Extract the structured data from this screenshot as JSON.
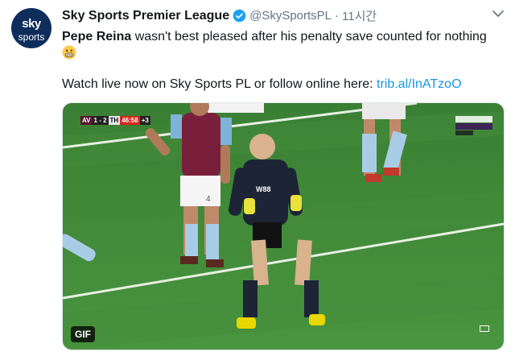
{
  "account": {
    "avatar_line1": "sky",
    "avatar_line2": "sports",
    "name": "Sky Sports Premier League",
    "handle": "@SkySportsPL",
    "separator": "·",
    "time": "11시간"
  },
  "tweet": {
    "subject": "Pepe Reina",
    "body": " wasn't best pleased after his penalty save counted for nothing ",
    "emoji": "grimacing-face-icon",
    "cta": "Watch live now on Sky Sports PL or follow online here: ",
    "link": "trib.al/InATzoO"
  },
  "media": {
    "scorebug": {
      "team1": "AV",
      "score": "1 - 2",
      "team2": "TH",
      "clock": "46:58",
      "extra": "+3"
    },
    "badge": "GIF",
    "player_sponsor": "W88",
    "player_number": "4"
  },
  "colors": {
    "link": "#1b95e0",
    "verified": "#1da1f2",
    "pitch": "#3f8a36",
    "avatar": "#0e2d5b"
  }
}
